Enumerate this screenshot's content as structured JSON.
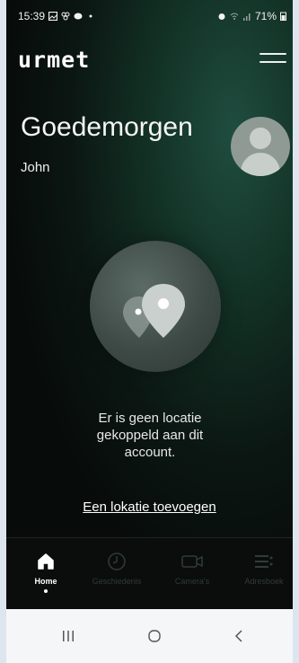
{
  "status_bar": {
    "time": "15:39",
    "battery": "71%"
  },
  "app": {
    "logo_text": "urmet"
  },
  "home": {
    "greeting": "Goedemorgen",
    "user_name": "John",
    "empty_message_lines": [
      "Er is geen locatie",
      "gekoppeld aan dit",
      "account."
    ],
    "add_location_link": "Een lokatie toevoegen"
  },
  "bottom_nav": {
    "items": [
      {
        "label": "Home",
        "icon": "home-icon",
        "active": true
      },
      {
        "label": "Geschiedenis",
        "icon": "clock-icon",
        "active": false
      },
      {
        "label": "Camera's",
        "icon": "camera-icon",
        "active": false
      },
      {
        "label": "Adresboek",
        "icon": "address-book-icon",
        "active": false
      }
    ]
  },
  "colors": {
    "active": "#ffffff",
    "inactive": "#2e3d38",
    "background": "#0b1612"
  }
}
